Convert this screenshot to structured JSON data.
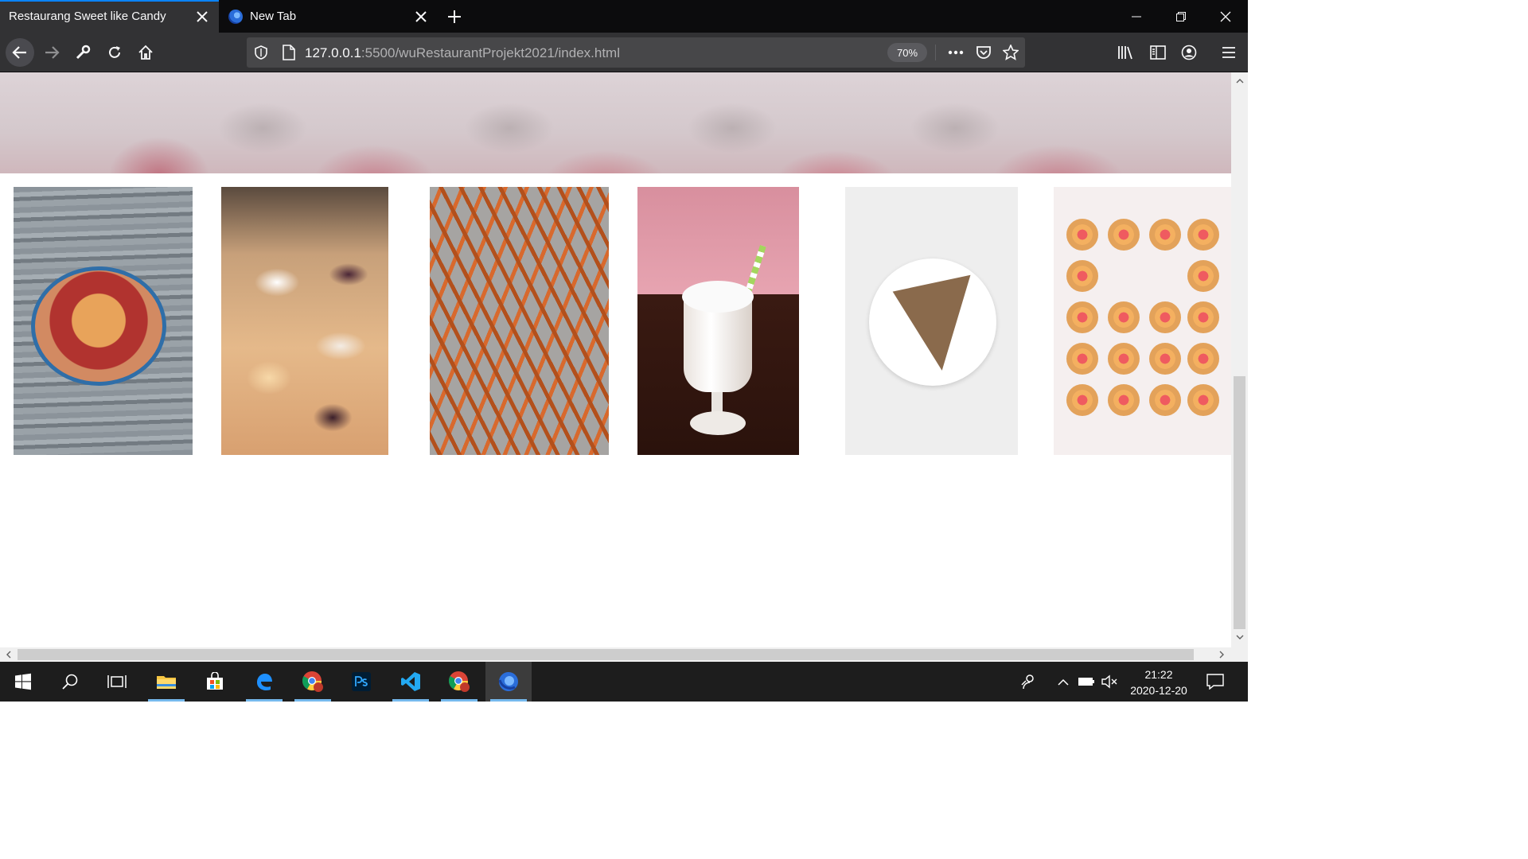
{
  "browser": {
    "tabs": [
      {
        "title": "Restaurang Sweet like Candy",
        "active": true
      },
      {
        "title": "New Tab",
        "active": false
      }
    ],
    "url_host": "127.0.0.1",
    "url_rest": ":5500/wuRestaurantProjekt2021/index.html",
    "zoom": "70%"
  },
  "page": {
    "gallery": [
      {
        "subject": "acai bowl with berries"
      },
      {
        "subject": "fruit pastries with icing"
      },
      {
        "subject": "sweet potato fries"
      },
      {
        "subject": "milkshake with straw"
      },
      {
        "subject": "slice of pizza on plate"
      },
      {
        "subject": "fruit tarts arranged in rows"
      }
    ]
  },
  "taskbar": {
    "time": "21:22",
    "date": "2020-12-20",
    "apps": [
      "start",
      "search",
      "task-view",
      "file-explorer",
      "microsoft-store",
      "edge",
      "chrome",
      "photoshop",
      "vscode",
      "chrome",
      "firefox"
    ]
  },
  "colors": {
    "tab_accent": "#0a84ff",
    "toolbar": "#323234",
    "tabstrip": "#0c0c0d",
    "taskbar": "#1d1d1d"
  }
}
